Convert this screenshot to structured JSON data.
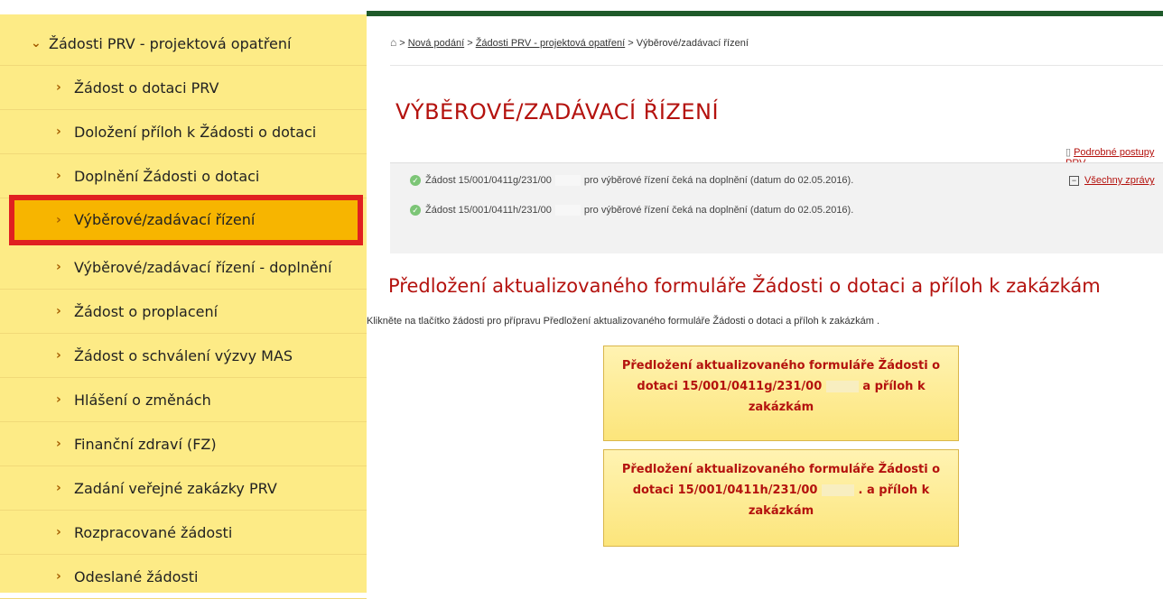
{
  "sidebar": {
    "parent_label": "Žádosti PRV - projektová opatření",
    "items": [
      {
        "label": "Žádost o dotaci PRV"
      },
      {
        "label": "Doložení příloh k Žádosti o dotaci"
      },
      {
        "label": "Doplnění Žádosti o dotaci"
      },
      {
        "label": "Výběrové/zadávací řízení",
        "active": true
      },
      {
        "label": "Výběrové/zadávací řízení - doplnění"
      },
      {
        "label": "Žádost o proplacení"
      },
      {
        "label": "Žádost o schválení výzvy MAS"
      },
      {
        "label": "Hlášení o změnách"
      },
      {
        "label": "Finanční zdraví (FZ)"
      },
      {
        "label": "Zadání veřejné zakázky PRV"
      },
      {
        "label": "Rozpracované žádosti"
      },
      {
        "label": "Odeslané žádosti"
      }
    ],
    "colors": {
      "background": "#fdeb86",
      "active": "#f7b500",
      "highlight_border": "#e02020"
    }
  },
  "breadcrumb": {
    "sep": ">",
    "link1": "Nová podání",
    "link2": "Žádosti PRV - projektová opatření",
    "current": "Výběrové/zadávací řízení"
  },
  "page_title": "VÝBĚROVÉ/ZADÁVACÍ ŘÍZENÍ",
  "procedures_link": "Podrobné postupy PRV",
  "messages": {
    "items": [
      {
        "prefix": "Žádost 15/001/0411g/231/00",
        "text": "pro výběrové řízení čeká na doplnění (datum do 02.05.2016)."
      },
      {
        "prefix": "Žádost 15/001/0411h/231/00",
        "text": "pro výběrové řízení čeká na doplnění (datum do 02.05.2016)."
      }
    ],
    "all_label": "Všechny zprávy"
  },
  "section_title": "Předložení aktualizovaného formuláře Žádosti o dotaci a příloh k zakázkám",
  "instruction": "Klikněte na tlačítko žádosti pro přípravu Předložení aktualizovaného formuláře Žádosti o dotaci a příloh k zakázkám .",
  "buttons": [
    {
      "line1": "Předložení aktualizovaného formuláře Žádosti o",
      "line2_prefix": "dotaci 15/001/0411g/231/00",
      "line2_suffix": "a příloh k",
      "line3": "zakázkám"
    },
    {
      "line1": "Předložení aktualizovaného formuláře Žádosti o",
      "line2_prefix": "dotaci 15/001/0411h/231/00",
      "line2_suffix": ". a příloh k",
      "line3": "zakázkám"
    }
  ],
  "colors": {
    "title_red": "#b4120e",
    "top_bar_green": "#1f5a2a"
  }
}
